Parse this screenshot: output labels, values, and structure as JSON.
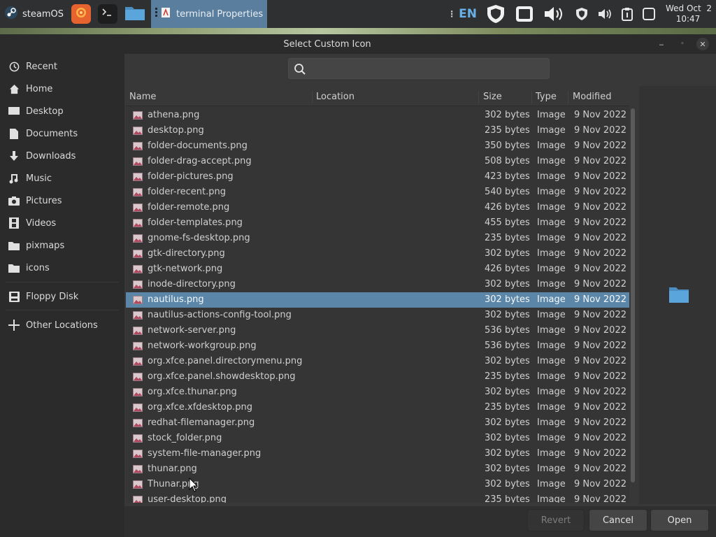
{
  "taskbar": {
    "start_label": "steamOS",
    "launchers": [
      {
        "icon": "firefox-icon",
        "color": "#e6622e"
      },
      {
        "icon": "terminal-icon",
        "color": "#1e1e1e"
      },
      {
        "icon": "folder-icon",
        "color": "#5a9fd4"
      }
    ],
    "window_button": {
      "label": "terminal Properties",
      "icon": "pdf-icon"
    },
    "tray": {
      "language": "EN",
      "icons": [
        "shield-icon",
        "battery-icon",
        "volume-icon",
        "shield-small-icon",
        "volume-small-icon",
        "clipboard-icon",
        "square-icon"
      ],
      "clock_date": "Wed Oct  2",
      "clock_time": "10:47"
    },
    "accent": "#5a7f9e"
  },
  "dialog": {
    "title": "Select Custom Icon",
    "window_buttons": [
      "minimize",
      "maximize",
      "close"
    ]
  },
  "sidebar": {
    "items": [
      {
        "label": "Recent",
        "icon": "clock-icon"
      },
      {
        "label": "Home",
        "icon": "home-icon"
      },
      {
        "label": "Desktop",
        "icon": "desktop-icon"
      },
      {
        "label": "Documents",
        "icon": "document-icon"
      },
      {
        "label": "Downloads",
        "icon": "download-icon"
      },
      {
        "label": "Music",
        "icon": "music-icon"
      },
      {
        "label": "Pictures",
        "icon": "camera-icon"
      },
      {
        "label": "Videos",
        "icon": "film-icon"
      },
      {
        "label": "pixmaps",
        "icon": "folder-icon"
      },
      {
        "label": "icons",
        "icon": "folder-icon"
      },
      {
        "label": "Floppy Disk",
        "icon": "drive-icon"
      },
      {
        "label": "Other Locations",
        "icon": "plus-icon"
      }
    ]
  },
  "search": {
    "placeholder": "",
    "value": ""
  },
  "columns": {
    "name": "Name",
    "location": "Location",
    "size": "Size",
    "type": "Type",
    "modified": "Modified"
  },
  "files": [
    {
      "name": "athena.png",
      "size": "302 bytes",
      "type": "Image",
      "modified": "9 Nov 2022"
    },
    {
      "name": "desktop.png",
      "size": "235 bytes",
      "type": "Image",
      "modified": "9 Nov 2022"
    },
    {
      "name": "folder-documents.png",
      "size": "350 bytes",
      "type": "Image",
      "modified": "9 Nov 2022"
    },
    {
      "name": "folder-drag-accept.png",
      "size": "508 bytes",
      "type": "Image",
      "modified": "9 Nov 2022"
    },
    {
      "name": "folder-pictures.png",
      "size": "423 bytes",
      "type": "Image",
      "modified": "9 Nov 2022"
    },
    {
      "name": "folder-recent.png",
      "size": "540 bytes",
      "type": "Image",
      "modified": "9 Nov 2022"
    },
    {
      "name": "folder-remote.png",
      "size": "426 bytes",
      "type": "Image",
      "modified": "9 Nov 2022"
    },
    {
      "name": "folder-templates.png",
      "size": "455 bytes",
      "type": "Image",
      "modified": "9 Nov 2022"
    },
    {
      "name": "gnome-fs-desktop.png",
      "size": "235 bytes",
      "type": "Image",
      "modified": "9 Nov 2022"
    },
    {
      "name": "gtk-directory.png",
      "size": "302 bytes",
      "type": "Image",
      "modified": "9 Nov 2022"
    },
    {
      "name": "gtk-network.png",
      "size": "426 bytes",
      "type": "Image",
      "modified": "9 Nov 2022"
    },
    {
      "name": "inode-directory.png",
      "size": "302 bytes",
      "type": "Image",
      "modified": "9 Nov 2022"
    },
    {
      "name": "nautilus.png",
      "size": "302 bytes",
      "type": "Image",
      "modified": "9 Nov 2022",
      "selected": true
    },
    {
      "name": "nautilus-actions-config-tool.png",
      "size": "302 bytes",
      "type": "Image",
      "modified": "9 Nov 2022"
    },
    {
      "name": "network-server.png",
      "size": "536 bytes",
      "type": "Image",
      "modified": "9 Nov 2022"
    },
    {
      "name": "network-workgroup.png",
      "size": "536 bytes",
      "type": "Image",
      "modified": "9 Nov 2022"
    },
    {
      "name": "org.xfce.panel.directorymenu.png",
      "size": "302 bytes",
      "type": "Image",
      "modified": "9 Nov 2022"
    },
    {
      "name": "org.xfce.panel.showdesktop.png",
      "size": "235 bytes",
      "type": "Image",
      "modified": "9 Nov 2022"
    },
    {
      "name": "org.xfce.thunar.png",
      "size": "302 bytes",
      "type": "Image",
      "modified": "9 Nov 2022"
    },
    {
      "name": "org.xfce.xfdesktop.png",
      "size": "235 bytes",
      "type": "Image",
      "modified": "9 Nov 2022"
    },
    {
      "name": "redhat-filemanager.png",
      "size": "302 bytes",
      "type": "Image",
      "modified": "9 Nov 2022"
    },
    {
      "name": "stock_folder.png",
      "size": "302 bytes",
      "type": "Image",
      "modified": "9 Nov 2022"
    },
    {
      "name": "system-file-manager.png",
      "size": "302 bytes",
      "type": "Image",
      "modified": "9 Nov 2022"
    },
    {
      "name": "thunar.png",
      "size": "302 bytes",
      "type": "Image",
      "modified": "9 Nov 2022"
    },
    {
      "name": "Thunar.png",
      "size": "302 bytes",
      "type": "Image",
      "modified": "9 Nov 2022"
    },
    {
      "name": "user-desktop.png",
      "size": "235 bytes",
      "type": "Image",
      "modified": "9 Nov 2022"
    }
  ],
  "preview": {
    "icon": "folder-icon",
    "color": "#5a9fd4"
  },
  "buttons": {
    "revert": "Revert",
    "cancel": "Cancel",
    "open": "Open"
  },
  "colors": {
    "selection": "#5b86a8",
    "folder": "#5a9fd4"
  }
}
